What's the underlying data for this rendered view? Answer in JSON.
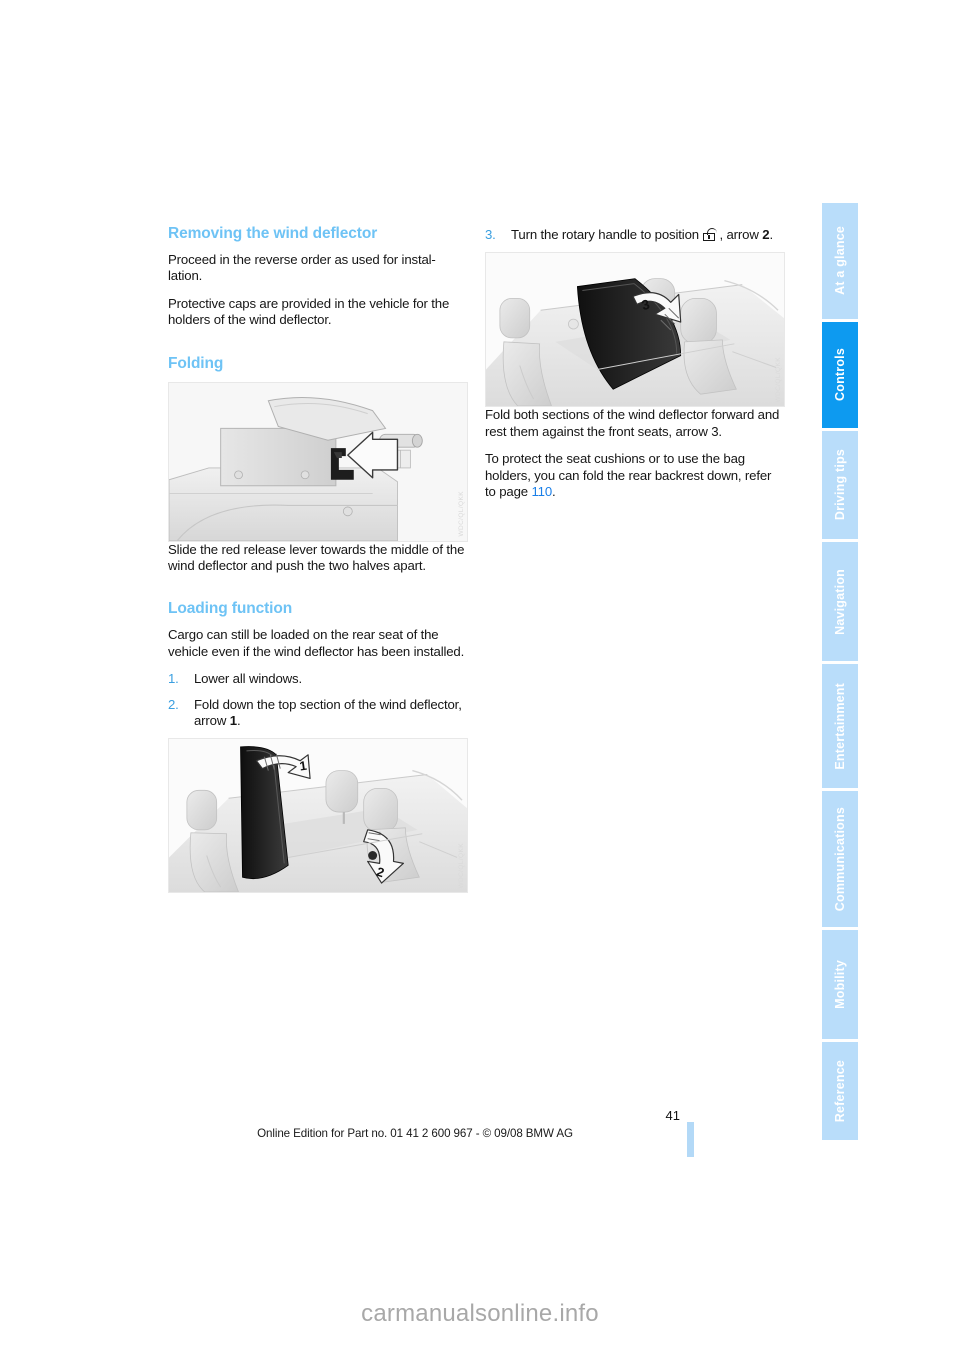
{
  "document": {
    "page_number": "41",
    "footer_text": "Online Edition for Part no. 01 41 2 600 967  - © 09/08 BMW AG",
    "watermark": "carmanualsonline.info"
  },
  "colors": {
    "heading_blue": "#6ec3f5",
    "list_number_blue": "#3a9fe0",
    "xref_blue": "#1a7fe8",
    "tab_inactive": "#b9ddfa",
    "tab_active": "#0d9af0",
    "footer_bar": "#b3d9f7"
  },
  "tabs": [
    {
      "label": "At a glance",
      "active": false
    },
    {
      "label": "Controls",
      "active": true
    },
    {
      "label": "Driving tips",
      "active": false
    },
    {
      "label": "Navigation",
      "active": false
    },
    {
      "label": "Entertainment",
      "active": false
    },
    {
      "label": "Communications",
      "active": false
    },
    {
      "label": "Mobility",
      "active": false
    },
    {
      "label": "Reference",
      "active": false
    }
  ],
  "left_column": {
    "heading_removing": "Removing the wind deflector",
    "para_reverse_order": "Proceed in the reverse order as used for instal-lation.",
    "para_protective_caps": "Protective caps are provided in the vehicle for the holders of the wind deflector.",
    "heading_folding": "Folding",
    "figure_folding": {
      "image_code": "WDC/QL/QKK",
      "alt": "Wind deflector release lever detail with arrow pointing left"
    },
    "para_slide_lever": "Slide the red release lever towards the middle of the wind deflector and push the two halves apart.",
    "heading_loading": "Loading function",
    "para_cargo": "Cargo can still be loaded on the rear seat of the vehicle even if the wind deflector has been installed.",
    "steps": [
      {
        "num": "1.",
        "text": "Lower all windows.",
        "bold": ""
      },
      {
        "num": "2.",
        "text_before": "Fold down the top section of the wind deflector, arrow ",
        "bold": "1",
        "text_after": "."
      }
    ],
    "figure_loading": {
      "image_code": "WDC/QL/QKK",
      "alt": "Convertible interior with wind deflector upright, arrows 1 and 2",
      "arrow_labels": [
        "1",
        "2"
      ]
    }
  },
  "right_column": {
    "step3": {
      "num": "3.",
      "text_before": "Turn the rotary handle to position ",
      "icon": "open-padlock-icon",
      "text_middle": ", arrow ",
      "bold": "2",
      "text_after": "."
    },
    "figure_rotary": {
      "image_code": "WDC/QL/QKK",
      "alt": "Convertible interior with wind deflector folded, arrow 3",
      "arrow_labels": [
        "3"
      ]
    },
    "para_fold_both": "Fold both sections of the wind deflector forward and rest them against the front seats, arrow 3.",
    "para_protect_before": "To protect the seat cushions or to use the bag holders, you can fold the rear backrest down, refer to page ",
    "para_protect_xref": "110",
    "para_protect_after": "."
  }
}
